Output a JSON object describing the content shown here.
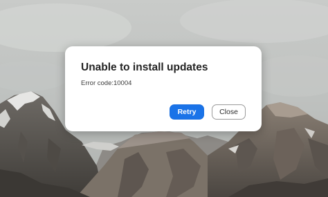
{
  "dialog": {
    "title": "Unable to install updates",
    "message": "Error code:10004",
    "retry_label": "Retry",
    "close_label": "Close"
  },
  "colors": {
    "primary_button": "#1a73e8",
    "dialog_background": "#ffffff"
  }
}
